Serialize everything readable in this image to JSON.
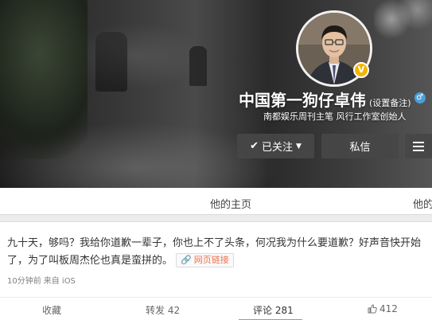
{
  "profile": {
    "name": "中国第一狗仔卓伟",
    "remark": "(设置备注)",
    "gender_symbol": "♂",
    "vip_symbol": "V",
    "bio": "南都娱乐周刊主笔 风行工作室创始人",
    "follow_button": "已关注",
    "message_button": "私信"
  },
  "tabs": {
    "home": "他的主页",
    "next": "他的"
  },
  "post": {
    "text": "九十天，够吗？我给你道歉一辈子，你也上不了头条，何况我为什么要道歉？好声音快开始了，为了叫板周杰伦也真是蛮拼的。",
    "link_label": "网页链接",
    "time": "10分钟前",
    "source": "来自 iOS"
  },
  "actions": {
    "favorite": "收藏",
    "forward": "转发 42",
    "comment": "评论 281",
    "like": "412"
  },
  "colors": {
    "accent_orange": "#fa7d3c",
    "link_orange": "#eb7350",
    "vip_gold": "#f4b400",
    "male_blue": "#4a9fd8"
  }
}
